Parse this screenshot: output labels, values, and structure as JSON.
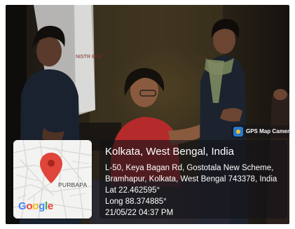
{
  "overlay": {
    "badge_label": "GPS Map Camera",
    "map_place": "PURBAPA",
    "map_brand": "Google",
    "title": "Kolkata, West Bengal, India",
    "address_line1": "L-50, Keya Bagan Rd, Gostotala New Scheme,",
    "address_line2": "Bramhapur, Kolkata, West Bengal 743378, India",
    "lat": "Lat 22.462595°",
    "long": "Long 88.374885°",
    "datetime": "21/05/22 04:37 PM"
  },
  "colors": {
    "pin": "#e0453a",
    "google_blue": "#4285f4",
    "google_red": "#ea4335",
    "google_yellow": "#fbbc05",
    "google_green": "#34a853"
  },
  "icons": [
    "map-pin-icon",
    "gps-camera-icon"
  ],
  "photo": {
    "wall_sign_text": "NISTR EGE"
  }
}
